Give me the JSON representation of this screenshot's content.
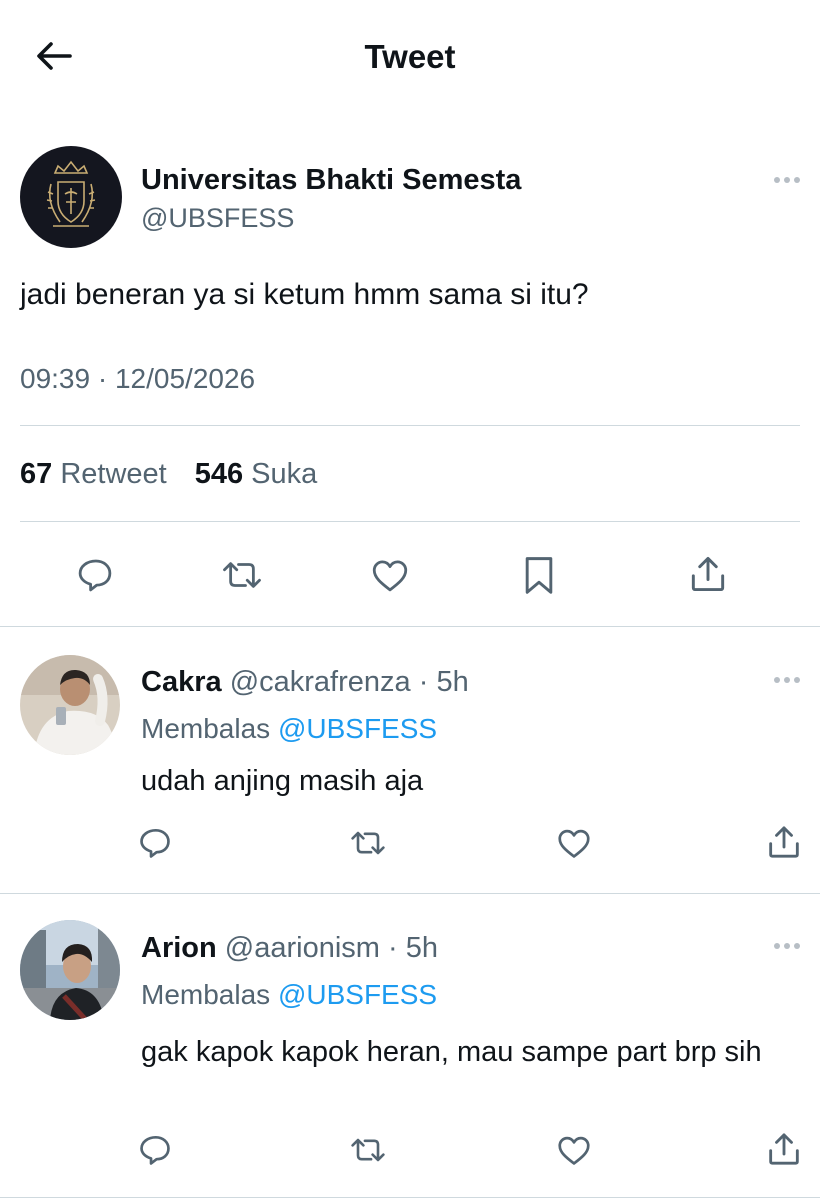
{
  "header": {
    "title": "Tweet",
    "back_icon": "arrow-left-icon"
  },
  "main_tweet": {
    "name": "Universitas Bhakti Semesta",
    "handle": "@UBSFESS",
    "text": "jadi beneran ya si ketum hmm sama si itu?",
    "time": "09:39",
    "separator": "·",
    "date": "12/05/2026",
    "retweet_count": "67",
    "retweet_label": "Retweet",
    "like_count": "546",
    "like_label": "Suka",
    "more_icon": "more-dots-icon",
    "actions": [
      "reply-icon",
      "retweet-icon",
      "like-icon",
      "bookmark-icon",
      "share-icon"
    ]
  },
  "replies": [
    {
      "name": "Cakra",
      "handle": "@cakrafrenza",
      "dot": "·",
      "time": "5h",
      "replying_label": "Membalas",
      "replying_to": "@UBSFESS",
      "text": "udah anjing masih aja"
    },
    {
      "name": "Arion",
      "handle": "@aarionism",
      "dot": "·",
      "time": "5h",
      "replying_label": "Membalas",
      "replying_to": "@UBSFESS",
      "text": "gak kapok kapok heran, mau sampe part brp sih"
    }
  ],
  "colors": {
    "text": "#0f1419",
    "secondary": "#536471",
    "link": "#1d9bf0",
    "divider": "#cfd9de"
  }
}
